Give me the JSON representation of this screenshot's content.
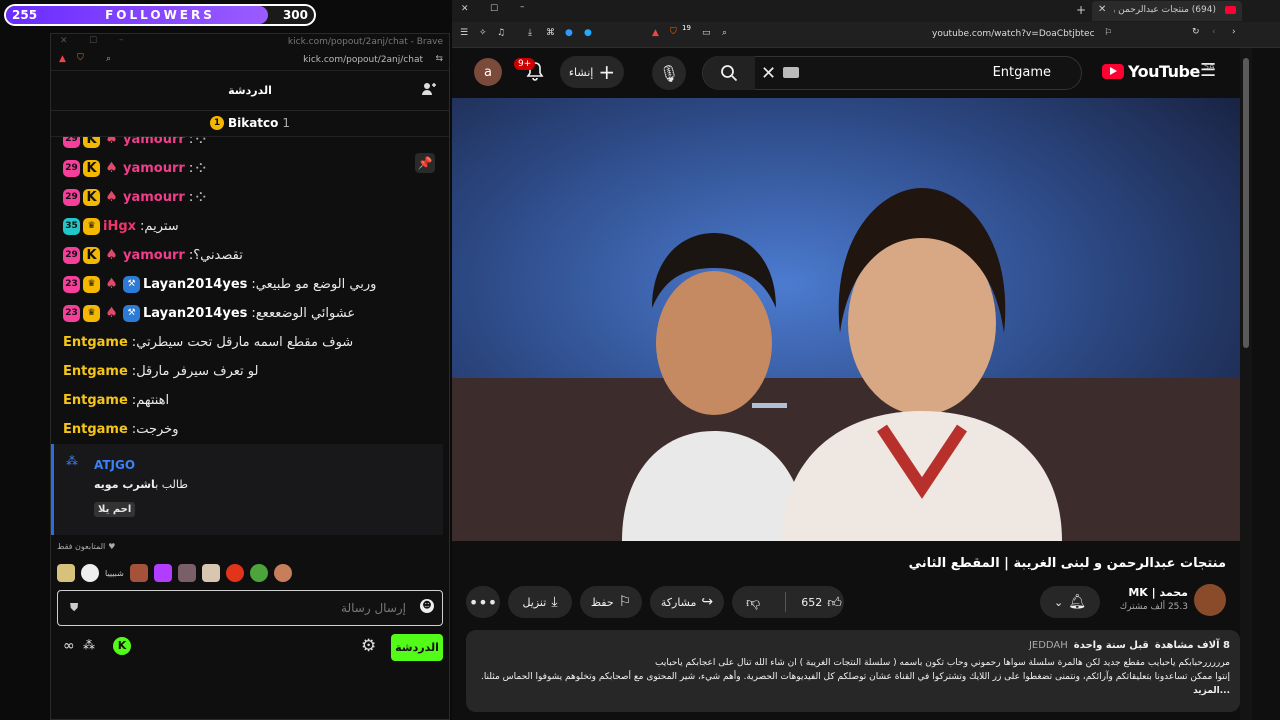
{
  "followers": {
    "label": "FOLLOWERS",
    "current": "255",
    "goal": "300",
    "progress_fraction": 0.85
  },
  "chat_window": {
    "url_title": "kick.com/popout/2anj/chat - Brave",
    "url": "kick.com/popout/2anj/chat",
    "header_title": "الدردشة",
    "top_gifter": {
      "name": "Bikatco",
      "count": "1",
      "rank": "1"
    },
    "messages": [
      {
        "badges": [
          "29"
        ],
        "user": "yamourr",
        "user_color": "#f23d8a",
        "text": ""
      },
      {
        "badges": [
          "29"
        ],
        "user": "yamourr",
        "user_color": "#f23d8a",
        "text": ""
      },
      {
        "badges": [
          "29"
        ],
        "user": "yamourr",
        "user_color": "#f23d8a",
        "text": ""
      },
      {
        "badges": [
          "35"
        ],
        "user": "iHgx",
        "user_color": "#f0356f",
        "text": "ستريم"
      },
      {
        "badges": [
          "29"
        ],
        "user": "yamourr",
        "user_color": "#f23d8a",
        "text": "تقصدني؟"
      },
      {
        "badges": [
          "23"
        ],
        "user": "Layan2014yes",
        "user_color": "#ffffff",
        "text": "وربي الوضع مو طبيعي"
      },
      {
        "badges": [
          "23"
        ],
        "user": "Layan2014yes",
        "user_color": "#ffffff",
        "text": "عشوائي الوضعععع"
      },
      {
        "badges": [],
        "user": "Entgame",
        "user_color": "#f5c518",
        "text": "شوف مقطع اسمه مارقل تحت سيطرتي"
      },
      {
        "badges": [],
        "user": "Entgame",
        "user_color": "#f5c518",
        "text": "لو تعرف سيرفر مارقل"
      },
      {
        "badges": [],
        "user": "Entgame",
        "user_color": "#f5c518",
        "text": "اهنتهم"
      },
      {
        "badges": [],
        "user": "Entgame",
        "user_color": "#f5c518",
        "text": "وخرجت"
      }
    ],
    "pinned": {
      "user": "ATJGO",
      "line1_prefix": "طالب ب",
      "line1_bold": "اشرب مويه",
      "line2": "احم يلا"
    },
    "followers_only": "المتابعون فقط",
    "emote_text": "شبيييا",
    "input_placeholder": "إرسال رسالة",
    "send_label": "الدردشة"
  },
  "browser": {
    "tab_title": "(694) منتجات عبدالرحمن و لبنى ال",
    "address": "youtube.com/watch?v=DoaCbtjbtec",
    "shield_count": "19"
  },
  "youtube": {
    "logo": "YouTube",
    "region": "SA",
    "search_value": "Entgame",
    "create_label": "إنشاء",
    "notif_badge": "9+",
    "avatar_letter": "a",
    "video_title": "منتجات عبدالرحمن و لبنى الغريبة | المقطع الثاني",
    "channel_name": "محمد | MK",
    "subscribers": "25.3 ألف مشترك",
    "likes": "652",
    "share_label": "مشاركة",
    "save_label": "حفظ",
    "download_label": "تنزيل",
    "views": "8 آلاف مشاهدة",
    "date": "قبل سنة واحدة",
    "location": "JEDDAH",
    "desc_line1": "مرررررحبابكم ياحبايب مقطع جديد لكن هالمرة سلسلة سواها رحموني وحاب تكون باسمه ( سلسلة النتجات الغريبة ) ان شاء الله تنال على اعجابكم ياحبايب",
    "desc_line2": "إنتوا ممكن تساعدونا بتعليقاتكم وآرائكم، ونتمنى تضغطوا على زر اللايك وتشتركوا في القناة عشان توصلكم كل الفيديوهات الحصرية. وأهم شيء، شير المحتوى مع أصحابكم وتخلوهم يشوفوا الحماس مثلنا.",
    "more": "...المزيد"
  },
  "colors": {
    "kick_green": "#53fc18",
    "yt_red": "#ff0033",
    "followers_purple": "#7b3cff"
  }
}
